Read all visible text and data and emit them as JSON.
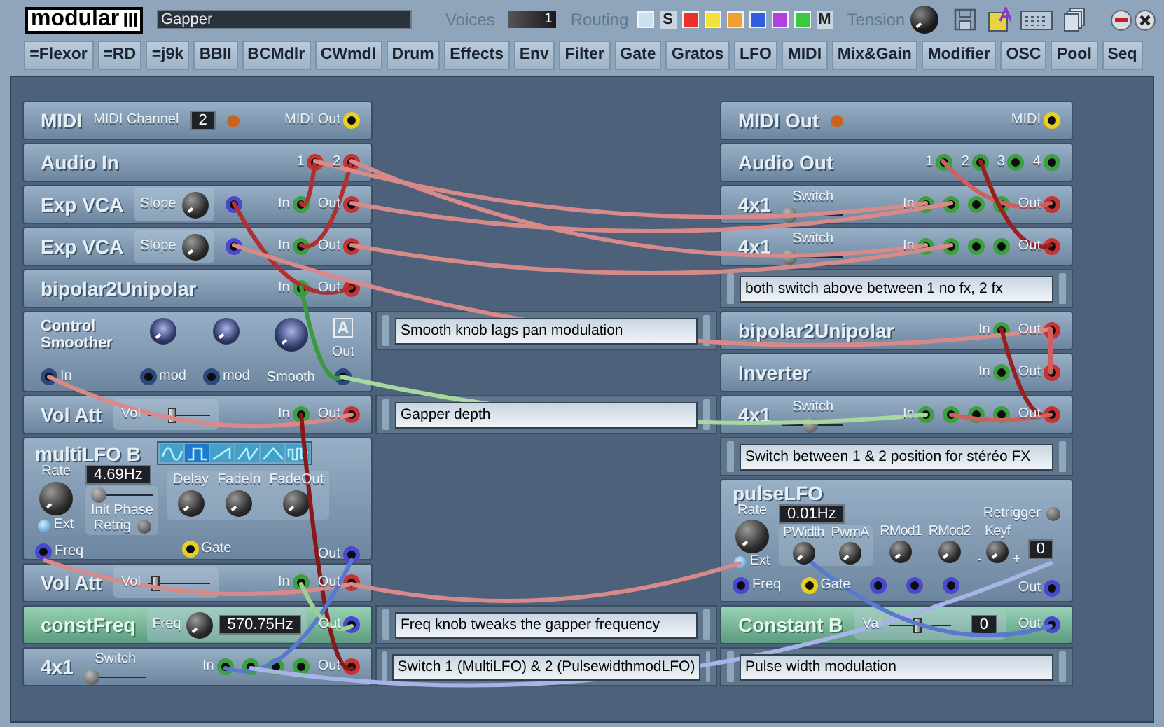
{
  "header": {
    "logo": "modular",
    "preset": "Gapper",
    "voices_label": "Voices",
    "voices": "1",
    "routing_label": "Routing",
    "routing": [
      {
        "kind": "swatch",
        "color": "#cfe0ee"
      },
      {
        "kind": "letter",
        "label": "S"
      },
      {
        "kind": "swatch",
        "color": "#e8322a"
      },
      {
        "kind": "swatch",
        "color": "#f2e23a"
      },
      {
        "kind": "swatch",
        "color": "#f0a030"
      },
      {
        "kind": "swatch",
        "color": "#2f5ee0"
      },
      {
        "kind": "swatch",
        "color": "#b040e0"
      },
      {
        "kind": "swatch",
        "color": "#3cc840"
      },
      {
        "kind": "letter",
        "label": "M"
      }
    ],
    "tension_label": "Tension"
  },
  "categories": [
    "=Flexor",
    "=RD",
    "=j9k",
    "BBII",
    "BCMdlr",
    "CWmdl",
    "Drum",
    "Effects",
    "Env",
    "Filter",
    "Gate",
    "Gratos",
    "LFO",
    "MIDI",
    "Mix&Gain",
    "Modifier",
    "OSC",
    "Pool",
    "Seq"
  ],
  "left_column": [
    {
      "kind": "strip",
      "title": "MIDI",
      "controls": [
        {
          "kind": "label",
          "text": "MIDI Channel"
        },
        {
          "kind": "display",
          "value": "2"
        },
        {
          "kind": "led",
          "color": "#c8641e"
        }
      ],
      "ports": [
        {
          "label": "MIDI Out",
          "color": "#e8d020"
        }
      ]
    },
    {
      "kind": "strip",
      "title": "Audio In",
      "ports": [
        {
          "label": "1",
          "color": "#c83232"
        },
        {
          "label": "2",
          "color": "#c83232"
        }
      ]
    },
    {
      "kind": "strip",
      "title": "Exp VCA",
      "controls": [
        {
          "kind": "knob",
          "label": "Slope"
        },
        {
          "kind": "port",
          "color": "#4848d0"
        }
      ],
      "ports": [
        {
          "label": "In",
          "color": "#3ca040"
        },
        {
          "label": "Out",
          "color": "#c83232"
        }
      ]
    },
    {
      "kind": "strip",
      "title": "Exp VCA",
      "controls": [
        {
          "kind": "knob",
          "label": "Slope"
        },
        {
          "kind": "port",
          "color": "#4848d0"
        }
      ],
      "ports": [
        {
          "label": "In",
          "color": "#3ca040"
        },
        {
          "label": "Out",
          "color": "#c83232"
        }
      ]
    },
    {
      "kind": "strip",
      "title": "bipolar2Unipolar",
      "ports": [
        {
          "label": "In",
          "color": "#3ca040"
        },
        {
          "label": "Out",
          "color": "#c83232"
        }
      ]
    },
    {
      "kind": "smoother",
      "title": "Control Smoother",
      "badge": "A",
      "in": {
        "label": "In",
        "color": "#2a4a7c"
      },
      "mods": [
        {
          "label": "mod",
          "color": "#2a4a7c"
        },
        {
          "label": "mod",
          "color": "#2a4a7c"
        }
      ],
      "smooth_label": "Smooth",
      "out": {
        "label": "Out",
        "color": "#2a4a7c"
      }
    },
    {
      "kind": "strip",
      "title": "Vol Att",
      "controls": [
        {
          "kind": "fader",
          "label": "Vol",
          "level": 0.35
        }
      ],
      "ports": [
        {
          "label": "In",
          "color": "#3ca040"
        },
        {
          "label": "Out",
          "color": "#c83232"
        }
      ]
    },
    {
      "kind": "multilfo",
      "title": "multiLFO B",
      "waveforms": [
        {
          "kind": "sine",
          "selected": false
        },
        {
          "kind": "square",
          "selected": true
        },
        {
          "kind": "saw",
          "selected": false
        },
        {
          "kind": "ramp",
          "selected": false
        },
        {
          "kind": "triangle",
          "selected": false
        },
        {
          "kind": "random",
          "selected": false
        }
      ],
      "rate_label": "Rate",
      "rate": "4.69Hz",
      "phase": {
        "level": 0
      },
      "phase_label": "Init Phase",
      "retrig_label": "Retrig",
      "ext_label": "Ext",
      "freq": {
        "label": "Freq",
        "color": "#4848d0"
      },
      "envelope": [
        {
          "label": "Delay"
        },
        {
          "label": "FadeIn"
        },
        {
          "label": "FadeOut"
        }
      ],
      "gate": {
        "label": "Gate",
        "color": "#e8d020"
      },
      "out": {
        "label": "Out",
        "color": "#4848d0"
      }
    },
    {
      "kind": "strip",
      "title": "Vol Att",
      "controls": [
        {
          "kind": "fader",
          "label": "Vol",
          "level": 0.05
        }
      ],
      "ports": [
        {
          "label": "In",
          "color": "#3ca040"
        },
        {
          "label": "Out",
          "color": "#c83232"
        }
      ]
    },
    {
      "kind": "green_strip",
      "title": "constFreq",
      "controls": [
        {
          "kind": "knob",
          "label": "Freq",
          "value": "570.75Hz"
        }
      ],
      "ports": [
        {
          "label": "Out",
          "color": "#4848d0"
        }
      ]
    },
    {
      "kind": "strip",
      "title": "4x1",
      "controls": [
        {
          "kind": "switch",
          "label": "Switch",
          "level": 0
        }
      ],
      "ports": [
        {
          "label": "In",
          "color": "#3ca040"
        },
        {
          "color": "#3ca040"
        },
        {
          "color": "#3ca040"
        },
        {
          "color": "#3ca040"
        },
        {
          "label": "Out",
          "color": "#c83232"
        }
      ]
    }
  ],
  "middle_column": [
    {
      "kind": "comment",
      "text": "Smooth knob lags pan modulation"
    },
    {
      "kind": "comment",
      "text": "Gapper depth"
    },
    {
      "kind": "comment",
      "text": "Freq knob tweaks the gapper frequency"
    },
    {
      "kind": "comment",
      "text": "Switch 1 (MultiLFO) & 2 (PulsewidthmodLFO)"
    }
  ],
  "right_column": [
    {
      "kind": "strip",
      "title": "MIDI Out",
      "controls": [
        {
          "kind": "led",
          "color": "#c8641e"
        }
      ],
      "ports": [
        {
          "label": "MIDI",
          "color": "#e8d020"
        }
      ]
    },
    {
      "kind": "strip",
      "title": "Audio Out",
      "ports": [
        {
          "label": "1",
          "color": "#3ca040"
        },
        {
          "label": "2",
          "color": "#3ca040"
        },
        {
          "label": "3",
          "color": "#3ca040"
        },
        {
          "label": "4",
          "color": "#3ca040"
        }
      ]
    },
    {
      "kind": "strip",
      "title": "4x1",
      "controls": [
        {
          "kind": "switch",
          "label": "Switch",
          "level": 0
        }
      ],
      "ports": [
        {
          "label": "In",
          "color": "#3ca040"
        },
        {
          "color": "#3ca040"
        },
        {
          "color": "#3ca040"
        },
        {
          "color": "#3ca040"
        },
        {
          "label": "Out",
          "color": "#c83232"
        }
      ]
    },
    {
      "kind": "strip",
      "title": "4x1",
      "controls": [
        {
          "kind": "switch",
          "label": "Switch",
          "level": 0
        }
      ],
      "ports": [
        {
          "label": "In",
          "color": "#3ca040"
        },
        {
          "color": "#3ca040"
        },
        {
          "color": "#3ca040"
        },
        {
          "color": "#3ca040"
        },
        {
          "label": "Out",
          "color": "#c83232"
        }
      ]
    },
    {
      "kind": "comment",
      "text": "both switch above between 1 no fx, 2 fx"
    },
    {
      "kind": "strip",
      "title": "bipolar2Unipolar",
      "ports": [
        {
          "label": "In",
          "color": "#3ca040"
        },
        {
          "label": "Out",
          "color": "#c83232"
        }
      ]
    },
    {
      "kind": "strip",
      "title": "Inverter",
      "ports": [
        {
          "label": "In",
          "color": "#3ca040"
        },
        {
          "label": "Out",
          "color": "#c83232"
        }
      ]
    },
    {
      "kind": "strip",
      "title": "4x1",
      "controls": [
        {
          "kind": "switch",
          "label": "Switch",
          "level": 0.45
        }
      ],
      "ports": [
        {
          "label": "In",
          "color": "#3ca040"
        },
        {
          "color": "#3ca040"
        },
        {
          "color": "#3ca040"
        },
        {
          "color": "#3ca040"
        },
        {
          "label": "Out",
          "color": "#c83232"
        }
      ]
    },
    {
      "kind": "comment",
      "text": "Switch between 1 & 2 position for stéréo FX"
    },
    {
      "kind": "pulselfo",
      "title": "pulseLFO",
      "rate_label": "Rate",
      "rate": "0.01Hz",
      "retrigger_label": "Retrigger",
      "knobs": [
        {
          "label": "PWidth"
        },
        {
          "label": "PwmA"
        },
        {
          "label": "RMod1"
        },
        {
          "label": "RMod2"
        },
        {
          "label": "Keyf"
        }
      ],
      "keyf_minus": "-",
      "keyf_plus": "+",
      "keyf_value": "0",
      "ext_label": "Ext",
      "freq": {
        "label": "Freq",
        "color": "#4848d0"
      },
      "gate": {
        "label": "Gate",
        "color": "#e8d020"
      },
      "mod_ports": [
        {
          "color": "#4848d0"
        },
        {
          "color": "#4848d0"
        },
        {
          "color": "#4848d0"
        }
      ],
      "out": {
        "label": "Out",
        "color": "#4848d0"
      }
    },
    {
      "kind": "green_strip",
      "title": "Constant B",
      "controls": [
        {
          "kind": "fader",
          "label": "Val",
          "level": 0.45,
          "value": "0"
        }
      ],
      "ports": [
        {
          "label": "Out",
          "color": "#4848d0"
        }
      ]
    },
    {
      "kind": "comment",
      "text": "Pulse width modulation"
    }
  ]
}
